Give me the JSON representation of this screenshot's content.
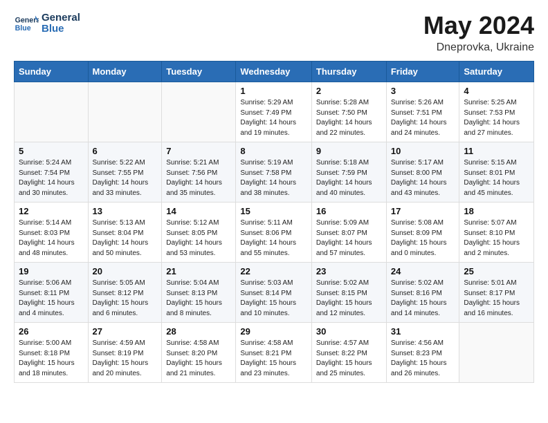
{
  "header": {
    "logo_line1": "General",
    "logo_line2": "Blue",
    "month_year": "May 2024",
    "location": "Dneprovka, Ukraine"
  },
  "days_of_week": [
    "Sunday",
    "Monday",
    "Tuesday",
    "Wednesday",
    "Thursday",
    "Friday",
    "Saturday"
  ],
  "weeks": [
    [
      {
        "day": "",
        "sunrise": "",
        "sunset": "",
        "daylight": ""
      },
      {
        "day": "",
        "sunrise": "",
        "sunset": "",
        "daylight": ""
      },
      {
        "day": "",
        "sunrise": "",
        "sunset": "",
        "daylight": ""
      },
      {
        "day": "1",
        "sunrise": "5:29 AM",
        "sunset": "7:49 PM",
        "daylight": "14 hours and 19 minutes."
      },
      {
        "day": "2",
        "sunrise": "5:28 AM",
        "sunset": "7:50 PM",
        "daylight": "14 hours and 22 minutes."
      },
      {
        "day": "3",
        "sunrise": "5:26 AM",
        "sunset": "7:51 PM",
        "daylight": "14 hours and 24 minutes."
      },
      {
        "day": "4",
        "sunrise": "5:25 AM",
        "sunset": "7:53 PM",
        "daylight": "14 hours and 27 minutes."
      }
    ],
    [
      {
        "day": "5",
        "sunrise": "5:24 AM",
        "sunset": "7:54 PM",
        "daylight": "14 hours and 30 minutes."
      },
      {
        "day": "6",
        "sunrise": "5:22 AM",
        "sunset": "7:55 PM",
        "daylight": "14 hours and 33 minutes."
      },
      {
        "day": "7",
        "sunrise": "5:21 AM",
        "sunset": "7:56 PM",
        "daylight": "14 hours and 35 minutes."
      },
      {
        "day": "8",
        "sunrise": "5:19 AM",
        "sunset": "7:58 PM",
        "daylight": "14 hours and 38 minutes."
      },
      {
        "day": "9",
        "sunrise": "5:18 AM",
        "sunset": "7:59 PM",
        "daylight": "14 hours and 40 minutes."
      },
      {
        "day": "10",
        "sunrise": "5:17 AM",
        "sunset": "8:00 PM",
        "daylight": "14 hours and 43 minutes."
      },
      {
        "day": "11",
        "sunrise": "5:15 AM",
        "sunset": "8:01 PM",
        "daylight": "14 hours and 45 minutes."
      }
    ],
    [
      {
        "day": "12",
        "sunrise": "5:14 AM",
        "sunset": "8:03 PM",
        "daylight": "14 hours and 48 minutes."
      },
      {
        "day": "13",
        "sunrise": "5:13 AM",
        "sunset": "8:04 PM",
        "daylight": "14 hours and 50 minutes."
      },
      {
        "day": "14",
        "sunrise": "5:12 AM",
        "sunset": "8:05 PM",
        "daylight": "14 hours and 53 minutes."
      },
      {
        "day": "15",
        "sunrise": "5:11 AM",
        "sunset": "8:06 PM",
        "daylight": "14 hours and 55 minutes."
      },
      {
        "day": "16",
        "sunrise": "5:09 AM",
        "sunset": "8:07 PM",
        "daylight": "14 hours and 57 minutes."
      },
      {
        "day": "17",
        "sunrise": "5:08 AM",
        "sunset": "8:09 PM",
        "daylight": "15 hours and 0 minutes."
      },
      {
        "day": "18",
        "sunrise": "5:07 AM",
        "sunset": "8:10 PM",
        "daylight": "15 hours and 2 minutes."
      }
    ],
    [
      {
        "day": "19",
        "sunrise": "5:06 AM",
        "sunset": "8:11 PM",
        "daylight": "15 hours and 4 minutes."
      },
      {
        "day": "20",
        "sunrise": "5:05 AM",
        "sunset": "8:12 PM",
        "daylight": "15 hours and 6 minutes."
      },
      {
        "day": "21",
        "sunrise": "5:04 AM",
        "sunset": "8:13 PM",
        "daylight": "15 hours and 8 minutes."
      },
      {
        "day": "22",
        "sunrise": "5:03 AM",
        "sunset": "8:14 PM",
        "daylight": "15 hours and 10 minutes."
      },
      {
        "day": "23",
        "sunrise": "5:02 AM",
        "sunset": "8:15 PM",
        "daylight": "15 hours and 12 minutes."
      },
      {
        "day": "24",
        "sunrise": "5:02 AM",
        "sunset": "8:16 PM",
        "daylight": "15 hours and 14 minutes."
      },
      {
        "day": "25",
        "sunrise": "5:01 AM",
        "sunset": "8:17 PM",
        "daylight": "15 hours and 16 minutes."
      }
    ],
    [
      {
        "day": "26",
        "sunrise": "5:00 AM",
        "sunset": "8:18 PM",
        "daylight": "15 hours and 18 minutes."
      },
      {
        "day": "27",
        "sunrise": "4:59 AM",
        "sunset": "8:19 PM",
        "daylight": "15 hours and 20 minutes."
      },
      {
        "day": "28",
        "sunrise": "4:58 AM",
        "sunset": "8:20 PM",
        "daylight": "15 hours and 21 minutes."
      },
      {
        "day": "29",
        "sunrise": "4:58 AM",
        "sunset": "8:21 PM",
        "daylight": "15 hours and 23 minutes."
      },
      {
        "day": "30",
        "sunrise": "4:57 AM",
        "sunset": "8:22 PM",
        "daylight": "15 hours and 25 minutes."
      },
      {
        "day": "31",
        "sunrise": "4:56 AM",
        "sunset": "8:23 PM",
        "daylight": "15 hours and 26 minutes."
      },
      {
        "day": "",
        "sunrise": "",
        "sunset": "",
        "daylight": ""
      }
    ]
  ]
}
